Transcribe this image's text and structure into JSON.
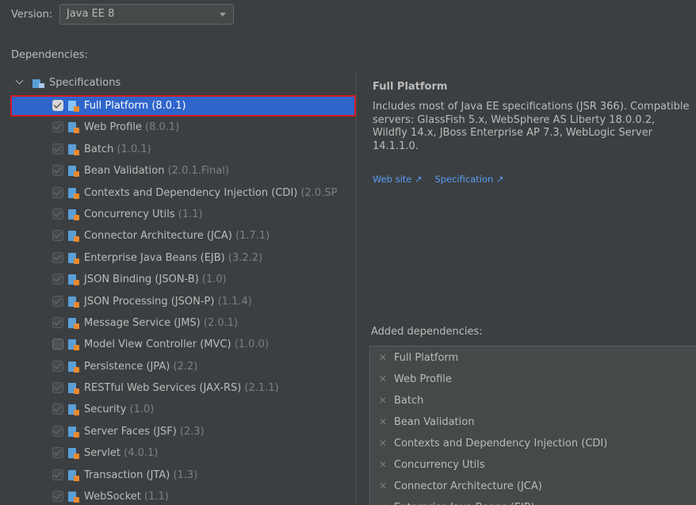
{
  "version": {
    "label": "Version:",
    "value": "Java EE 8"
  },
  "dependencies_label": "Dependencies:",
  "tree": {
    "root_label": "Specifications",
    "items": [
      {
        "name": "Full Platform",
        "version": "(8.0.1)",
        "checked": true,
        "selected": true
      },
      {
        "name": "Web Profile",
        "version": "(8.0.1)",
        "checked": true
      },
      {
        "name": "Batch",
        "version": "(1.0.1)",
        "checked": true
      },
      {
        "name": "Bean Validation",
        "version": "(2.0.1.Final)",
        "checked": true
      },
      {
        "name": "Contexts and Dependency Injection (CDI)",
        "version": "(2.0.SP",
        "checked": true
      },
      {
        "name": "Concurrency Utils",
        "version": "(1.1)",
        "checked": true
      },
      {
        "name": "Connector Architecture (JCA)",
        "version": "(1.7.1)",
        "checked": true
      },
      {
        "name": "Enterprise Java Beans (EJB)",
        "version": "(3.2.2)",
        "checked": true
      },
      {
        "name": "JSON Binding (JSON-B)",
        "version": "(1.0)",
        "checked": true
      },
      {
        "name": "JSON Processing (JSON-P)",
        "version": "(1.1.4)",
        "checked": true
      },
      {
        "name": "Message Service (JMS)",
        "version": "(2.0.1)",
        "checked": true
      },
      {
        "name": "Model View Controller (MVC)",
        "version": "(1.0.0)",
        "checked": false
      },
      {
        "name": "Persistence (JPA)",
        "version": "(2.2)",
        "checked": true
      },
      {
        "name": "RESTful Web Services (JAX-RS)",
        "version": "(2.1.1)",
        "checked": true
      },
      {
        "name": "Security",
        "version": "(1.0)",
        "checked": true
      },
      {
        "name": "Server Faces (JSF)",
        "version": "(2.3)",
        "checked": true
      },
      {
        "name": "Servlet",
        "version": "(4.0.1)",
        "checked": true
      },
      {
        "name": "Transaction (JTA)",
        "version": "(1.3)",
        "checked": true
      },
      {
        "name": "WebSocket",
        "version": "(1.1)",
        "checked": true
      }
    ]
  },
  "info": {
    "title": "Full Platform",
    "description": "Includes most of Java EE specifications (JSR 366). Compatible servers: GlassFish 5.x, WebSphere AS Liberty 18.0.0.2, Wildfly 14.x, JBoss Enterprise AP 7.3, WebLogic Server 14.1.1.0.",
    "link_website": "Web site ↗",
    "link_spec": "Specification ↗"
  },
  "added": {
    "label": "Added dependencies:",
    "items": [
      "Full Platform",
      "Web Profile",
      "Batch",
      "Bean Validation",
      "Contexts and Dependency Injection (CDI)",
      "Concurrency Utils",
      "Connector Architecture (JCA)",
      "Enterprise Java Beans (EJB)"
    ]
  },
  "colors": {
    "selection": "#2f65ca",
    "highlight_border": "#d01b24",
    "link": "#589df6"
  }
}
